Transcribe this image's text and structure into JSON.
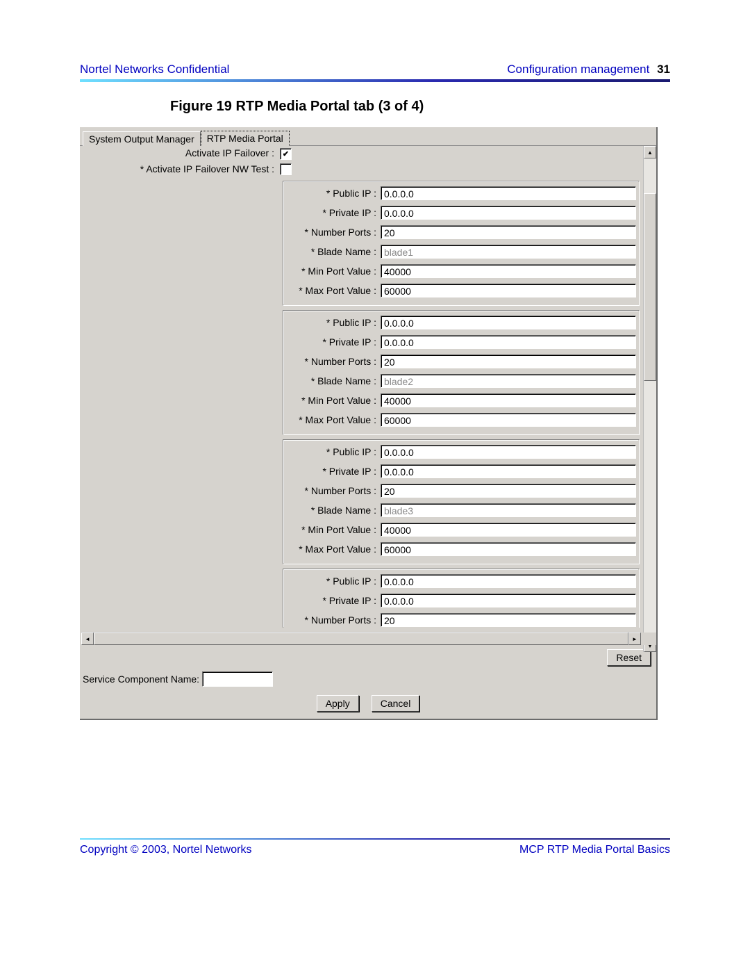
{
  "header": {
    "left": "Nortel Networks Confidential",
    "right_title": "Configuration management",
    "page_number": "31"
  },
  "figure_title": "Figure 19  RTP Media Portal tab (3 of 4)",
  "tabs": {
    "inactive": "System Output Manager",
    "active": "RTP Media Portal"
  },
  "top_fields": {
    "activate_ip_failover_label": "Activate IP Failover :",
    "activate_ip_failover_checked": true,
    "activate_ip_failover_nw_test_label": "* Activate IP Failover NW Test :",
    "activate_ip_failover_nw_test_checked": false
  },
  "blade_labels": {
    "public_ip": "* Public IP :",
    "private_ip": "* Private IP :",
    "number_ports": "* Number Ports :",
    "blade_name": "* Blade Name :",
    "min_port": "* Min Port Value :",
    "max_port": "* Max Port Value :"
  },
  "blades": [
    {
      "public_ip": "0.0.0.0",
      "private_ip": "0.0.0.0",
      "number_ports": "20",
      "blade_name": "blade1",
      "min_port": "40000",
      "max_port": "60000"
    },
    {
      "public_ip": "0.0.0.0",
      "private_ip": "0.0.0.0",
      "number_ports": "20",
      "blade_name": "blade2",
      "min_port": "40000",
      "max_port": "60000"
    },
    {
      "public_ip": "0.0.0.0",
      "private_ip": "0.0.0.0",
      "number_ports": "20",
      "blade_name": "blade3",
      "min_port": "40000",
      "max_port": "60000"
    }
  ],
  "partial_blade": {
    "public_ip": "0.0.0.0",
    "private_ip": "0.0.0.0",
    "number_ports": "20"
  },
  "buttons": {
    "reset": "Reset",
    "apply": "Apply",
    "cancel": "Cancel"
  },
  "service_component_label": "Service Component Name:",
  "service_component_value": "",
  "footer": {
    "left": "Copyright © 2003, Nortel Networks",
    "right": "MCP RTP Media Portal Basics"
  }
}
